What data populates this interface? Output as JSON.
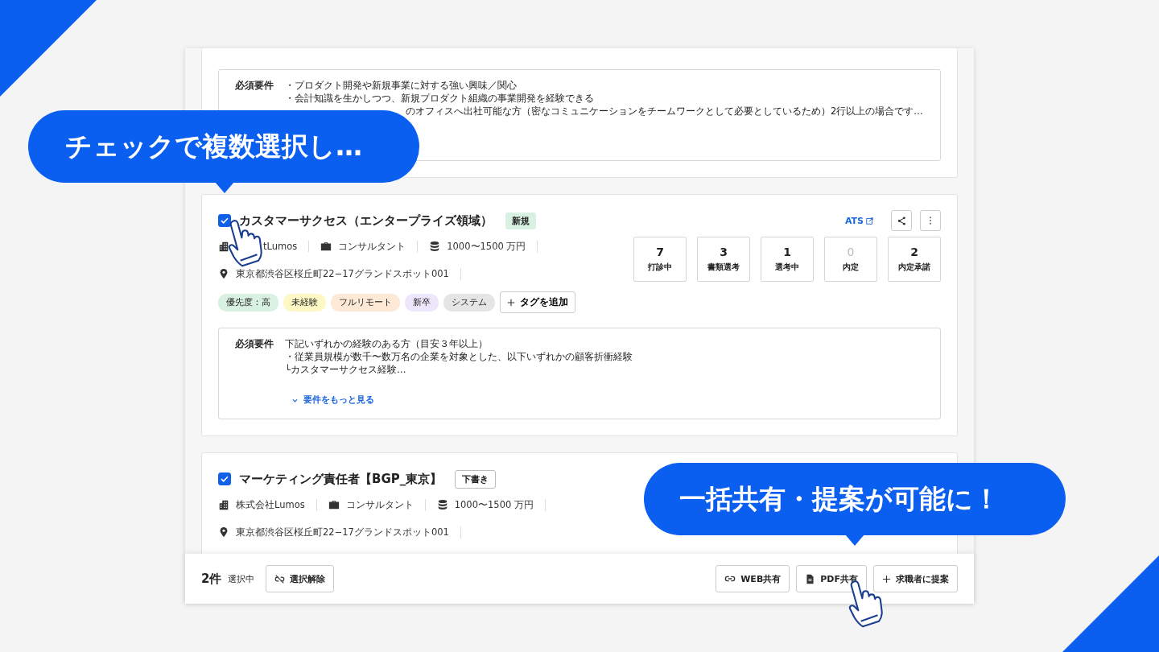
{
  "callouts": [
    {
      "text": "チェックで複数選択し…"
    },
    {
      "text": "一括共有・提案が可能に！"
    }
  ],
  "jobs": [
    {
      "requirements": {
        "label": "必須要件",
        "lines": [
          {
            "kind": "line",
            "text": "・プロダクト開発や新規事業に対する強い興味／関心"
          },
          {
            "kind": "line",
            "text": "・会計知識を生かしつつ、新規プロダクト組織の事業開発を経験できる"
          },
          {
            "kind": "covered",
            "text": "のオフィスへ出社可能な方（密なコミュニケーションをチームワークとして必要としているため）2行以上の場合です…"
          }
        ]
      }
    },
    {
      "checked": true,
      "title": "カスタマーサクセス（エンタープライズ領域）",
      "badge": {
        "kind": "new",
        "text": "新規"
      },
      "ats": "ATS",
      "meta": [
        {
          "kind": "company",
          "text": "tLumos"
        },
        {
          "kind": "role",
          "text": "コンサルタント"
        },
        {
          "kind": "salary",
          "text": "1000〜1500 万円"
        }
      ],
      "location": "東京都渋谷区桜丘町22−17グランドスポット001",
      "tags": [
        {
          "text": "優先度：高",
          "color": "#d8f1e2"
        },
        {
          "text": "未経験",
          "color": "#fdf8c4"
        },
        {
          "text": "フルリモート",
          "color": "#fde9d6"
        },
        {
          "text": "新卒",
          "color": "#ece7fb"
        },
        {
          "text": "システム",
          "color": "#e5e5e5"
        }
      ],
      "add_tag": "タグを追加",
      "stats": [
        {
          "value": "7",
          "label": "打診中",
          "disabled": false
        },
        {
          "value": "3",
          "label": "書類選考",
          "disabled": false
        },
        {
          "value": "1",
          "label": "選考中",
          "disabled": false
        },
        {
          "value": "0",
          "label": "内定",
          "disabled": true
        },
        {
          "value": "2",
          "label": "内定承諾",
          "disabled": false
        }
      ],
      "requirements": {
        "label": "必須要件",
        "lines": [
          {
            "kind": "line",
            "text": "下記いずれかの経験のある方（目安３年以上）"
          },
          {
            "kind": "line",
            "text": "・従業員規模が数千〜数万名の企業を対象とした、以下いずれかの顧客折衝経験"
          },
          {
            "kind": "line",
            "text": "└カスタマーサクセス経験…"
          }
        ],
        "more": "要件をもっと見る"
      }
    },
    {
      "checked": true,
      "title": "マーケティング責任者【BGP_東京】",
      "badge": {
        "kind": "draft",
        "text": "下書き"
      },
      "meta": [
        {
          "kind": "company",
          "text": "株式会社Lumos"
        },
        {
          "kind": "role",
          "text": "コンサルタント"
        },
        {
          "kind": "salary",
          "text": "1000〜1500 万円"
        }
      ],
      "location": "東京都渋谷区桜丘町22−17グランドスポット001"
    }
  ],
  "selection_bar": {
    "count": "2件",
    "count_label": "選択中",
    "clear": "選択解除",
    "actions": [
      {
        "kind": "link",
        "text": "WEB共有"
      },
      {
        "kind": "doc",
        "text": "PDF共有"
      },
      {
        "kind": "plus",
        "text": "求職者に提案"
      }
    ]
  }
}
